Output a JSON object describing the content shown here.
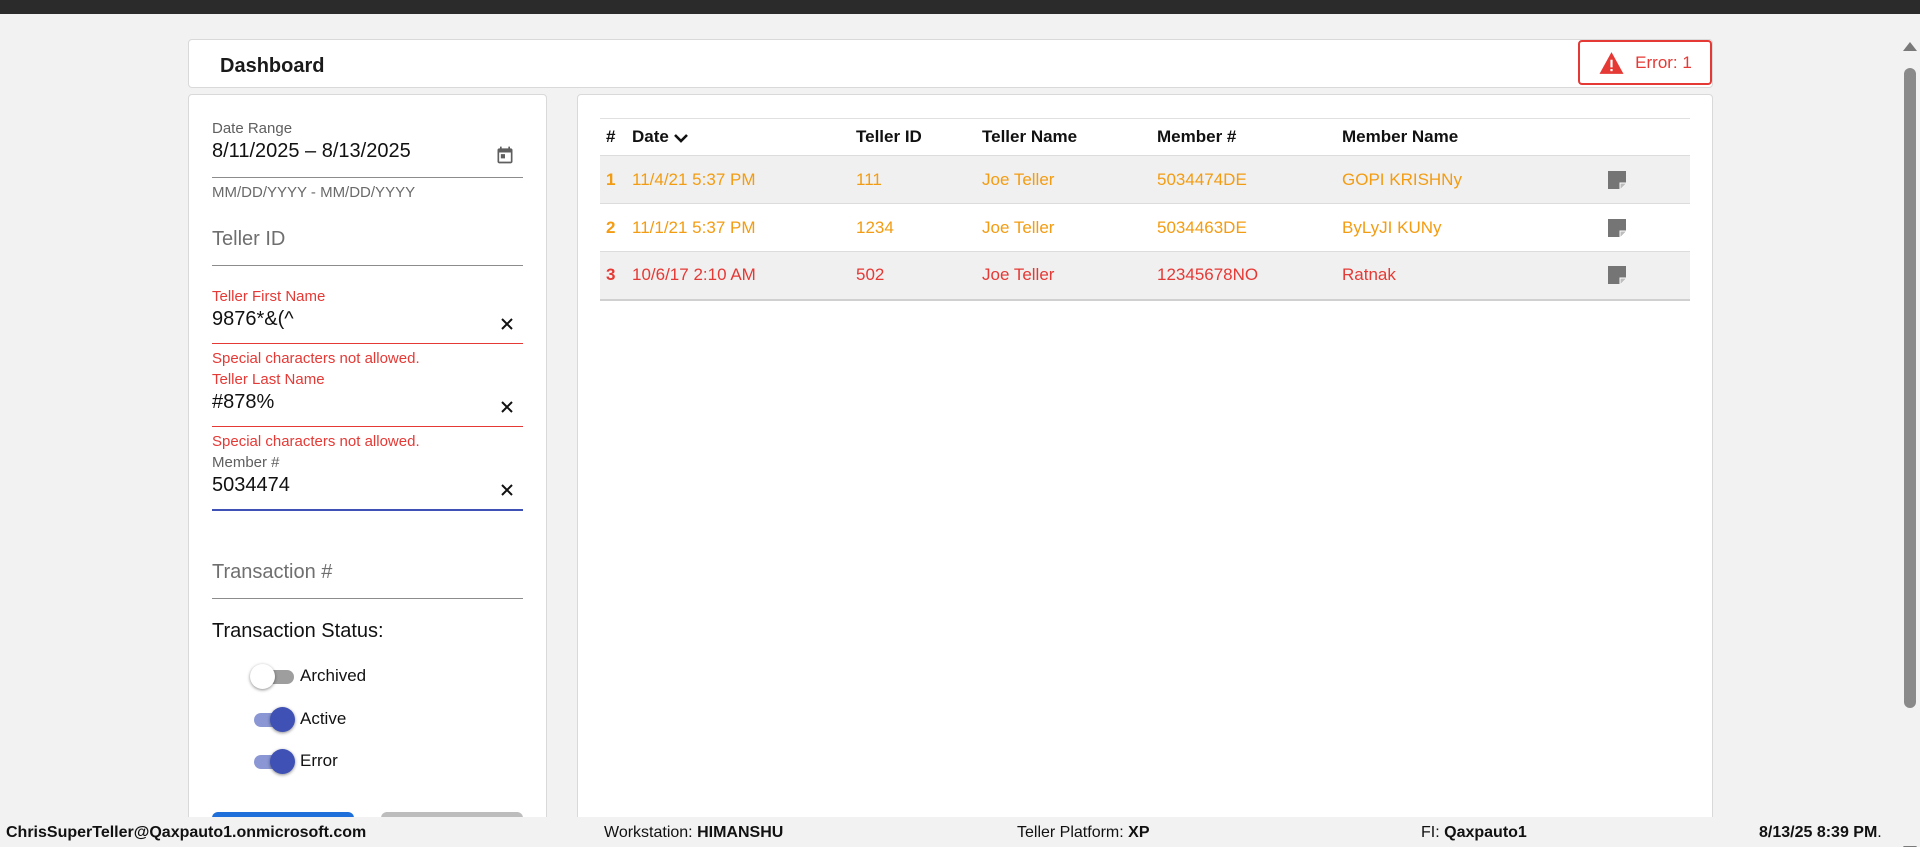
{
  "header": {
    "title": "Dashboard",
    "error_label": "Error: 1"
  },
  "filters": {
    "date_range": {
      "label": "Date Range",
      "value": "8/11/2025 – 8/13/2025",
      "hint": "MM/DD/YYYY - MM/DD/YYYY"
    },
    "teller_id": {
      "placeholder": "Teller ID",
      "value": ""
    },
    "teller_first_name": {
      "label": "Teller First Name",
      "value": "9876*&(^",
      "error": "Special characters not allowed."
    },
    "teller_last_name": {
      "label": "Teller Last Name",
      "value": "#878%",
      "error": "Special characters not allowed."
    },
    "member_number": {
      "label": "Member #",
      "value": "5034474"
    },
    "transaction_number": {
      "placeholder": "Transaction #",
      "value": ""
    },
    "status_title": "Transaction Status:",
    "statuses": [
      {
        "label": "Archived",
        "on": false
      },
      {
        "label": "Active",
        "on": true
      },
      {
        "label": "Error",
        "on": true
      }
    ]
  },
  "table": {
    "columns": [
      "#",
      "Date",
      "Teller ID",
      "Teller Name",
      "Member #",
      "Member Name"
    ],
    "rows": [
      {
        "idx": "1",
        "date": "11/4/21 5:37 PM",
        "teller_id": "111",
        "teller_name": "Joe Teller",
        "member_num": "5034474DE",
        "member_name": "GOPI KRISHNy",
        "status": "active"
      },
      {
        "idx": "2",
        "date": "11/1/21 5:37 PM",
        "teller_id": "1234",
        "teller_name": "Joe Teller",
        "member_num": "5034463DE",
        "member_name": "ByLyJI KUNy",
        "status": "active"
      },
      {
        "idx": "3",
        "date": "10/6/17 2:10 AM",
        "teller_id": "502",
        "teller_name": "Joe Teller",
        "member_num": "12345678NO",
        "member_name": "Ratnak",
        "status": "error"
      }
    ]
  },
  "footer": {
    "user": "ChrisSuperTeller@Qaxpauto1.onmicrosoft.com",
    "workstation_label": "Workstation:",
    "workstation": "HIMANSHU",
    "platform_label": "Teller Platform:",
    "platform": "XP",
    "fi_label": "FI:",
    "fi": "Qaxpauto1",
    "datetime": "8/13/25 8:39 PM"
  },
  "colors": {
    "active_row": "#f39c12",
    "error_row": "#e53935",
    "accent": "#3f51b5",
    "error": "#e53935"
  }
}
